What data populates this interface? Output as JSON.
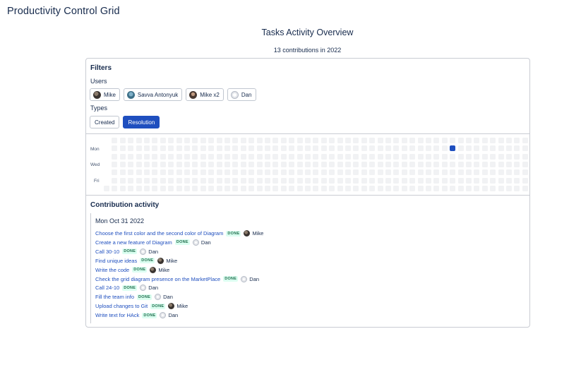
{
  "app": {
    "title": "Productivity Control Grid"
  },
  "overview": {
    "title": "Tasks Activity Overview",
    "count_text": "13 contributions in 2022"
  },
  "filters": {
    "heading": "Filters",
    "users_label": "Users",
    "users": [
      {
        "name": "Mike",
        "avatar": "avatar-mike"
      },
      {
        "name": "Savva Antonyuk",
        "avatar": "avatar-savva"
      },
      {
        "name": "Mike x2",
        "avatar": "avatar-mike2"
      },
      {
        "name": "Dan",
        "avatar": "avatar-dan"
      }
    ],
    "types_label": "Types",
    "types": [
      {
        "label": "Created",
        "selected": false
      },
      {
        "label": "Resolution",
        "selected": true
      }
    ]
  },
  "heatmap": {
    "day_labels": {
      "mon": "Mon",
      "wed": "Wed",
      "fri": "Fri"
    },
    "empty_color": "#f1f2f4",
    "active_color": "#1f4fbf",
    "active_cells": [
      {
        "week": 43,
        "day": "Mon"
      }
    ]
  },
  "activity": {
    "heading": "Contribution activity",
    "date": "Mon Oct 31 2022",
    "status_label": "DONE",
    "entries": [
      {
        "title": "Choose the first color and the second color of Diagram",
        "assignee": "Mike",
        "avatar": "avatar-mike"
      },
      {
        "title": "Create a new feature of Diagram",
        "assignee": "Dan",
        "avatar": "avatar-dan"
      },
      {
        "title": "Call 30-10",
        "assignee": "Dan",
        "avatar": "avatar-dan"
      },
      {
        "title": "Find unique ideas",
        "assignee": "Mike",
        "avatar": "avatar-mike"
      },
      {
        "title": "Write the code",
        "assignee": "Mike",
        "avatar": "avatar-mike"
      },
      {
        "title": "Check the grid diagram presence on the MarketPlace",
        "assignee": "Dan",
        "avatar": "avatar-dan"
      },
      {
        "title": "Call 24-10",
        "assignee": "Dan",
        "avatar": "avatar-dan"
      },
      {
        "title": "Fill the team info",
        "assignee": "Dan",
        "avatar": "avatar-dan"
      },
      {
        "title": "Upload changes to Git",
        "assignee": "Mike",
        "avatar": "avatar-mike"
      },
      {
        "title": "Write text for HAck",
        "assignee": "Dan",
        "avatar": "avatar-dan"
      }
    ]
  }
}
